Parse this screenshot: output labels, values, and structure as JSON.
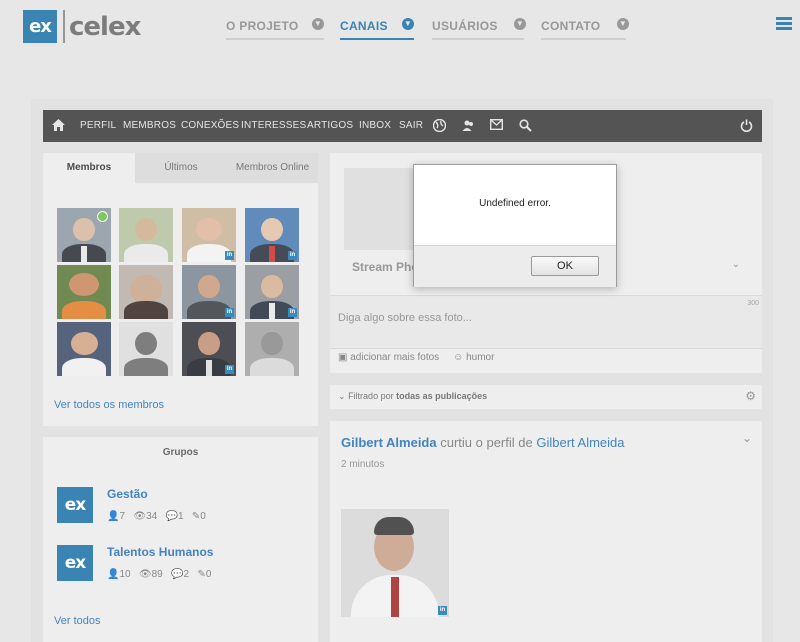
{
  "brand": {
    "badge": "ex",
    "name": "celex",
    "color": "#1e73a8"
  },
  "topnav": [
    {
      "label": "O PROJETO",
      "active": false
    },
    {
      "label": "CANAIS",
      "active": true
    },
    {
      "label": "USUÁRIOS",
      "active": false
    },
    {
      "label": "CONTATO",
      "active": false
    }
  ],
  "toolbar": {
    "items": [
      "PERFIL",
      "MEMBROS",
      "CONEXÕES",
      "INTERESSES",
      "ARTIGOS",
      "INBOX",
      "SAIR"
    ],
    "icons": [
      "home-icon",
      "globe-icon",
      "users-icon",
      "mail-icon",
      "search-icon",
      "power-icon"
    ]
  },
  "members": {
    "tabs": [
      "Membros",
      "Últimos",
      "Membros Online"
    ],
    "see_all": "Ver todos os membros"
  },
  "groups": {
    "title": "Grupos",
    "items": [
      {
        "badge": "ex",
        "name": "Gestão",
        "members": "7",
        "views": "34",
        "comments": "1",
        "posts": "0"
      },
      {
        "badge": "ex",
        "name": "Talentos Humanos",
        "members": "10",
        "views": "89",
        "comments": "2",
        "posts": "0"
      }
    ],
    "see_all": "Ver todos"
  },
  "stream": {
    "title": "Stream Photo",
    "placeholder": "Diga algo sobre essa foto...",
    "counter": "300",
    "add_photos": "adicionar mais fotos",
    "humor": "humor"
  },
  "filter": {
    "prefix": "Filtrado por",
    "value": "todas as publicações"
  },
  "post": {
    "actor": "Gilbert Almeida",
    "verb": "curtiu o perfil de",
    "target": "Gilbert Almeida",
    "time": "2 minutos"
  },
  "dialog": {
    "message": "Undefined error.",
    "ok_label": "OK"
  }
}
